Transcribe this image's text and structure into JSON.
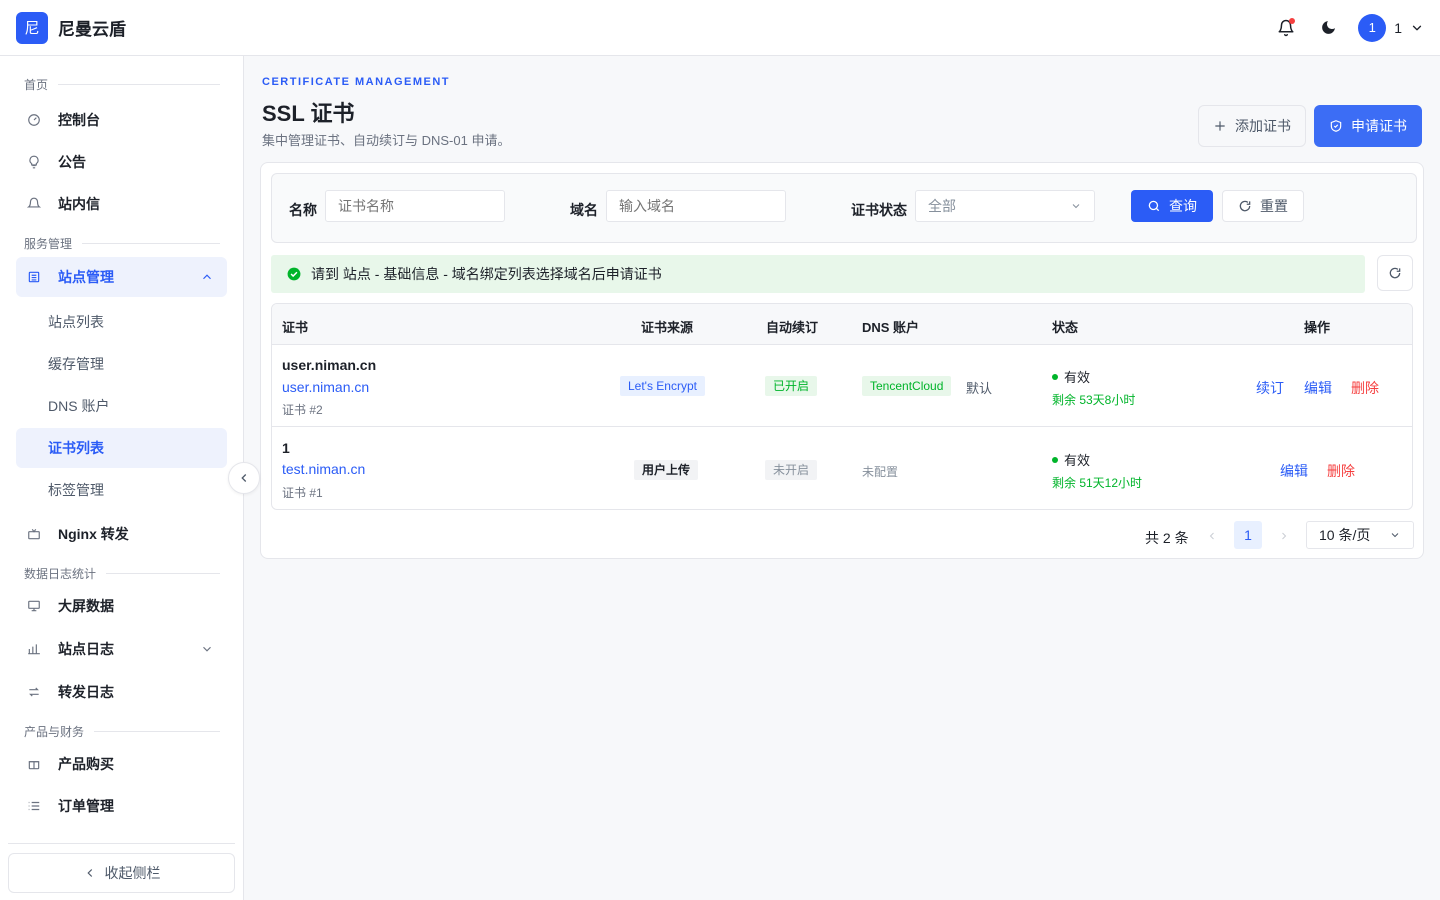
{
  "header": {
    "logo_char": "尼",
    "brand": "尼曼云盾",
    "user_avatar": "1",
    "user_name": "1"
  },
  "sidebar": {
    "section_home": "首页",
    "item_console": "控制台",
    "item_notice": "公告",
    "item_message": "站内信",
    "section_service": "服务管理",
    "item_site": "站点管理",
    "sub_site_list": "站点列表",
    "sub_cache": "缓存管理",
    "sub_dns": "DNS 账户",
    "sub_cert": "证书列表",
    "sub_tags": "标签管理",
    "item_nginx": "Nginx 转发",
    "section_stats": "数据日志统计",
    "item_bigscreen": "大屏数据",
    "item_sitelog": "站点日志",
    "item_forwardlog": "转发日志",
    "section_finance": "产品与财务",
    "item_buy": "产品购买",
    "item_orders": "订单管理",
    "collapse": "收起侧栏"
  },
  "page": {
    "eyebrow": "CERTIFICATE MANAGEMENT",
    "title": "SSL 证书",
    "subtitle": "集中管理证书、自动续订与 DNS-01 申请。",
    "add_button": "添加证书",
    "apply_button": "申请证书"
  },
  "filter": {
    "name_label": "名称",
    "name_placeholder": "证书名称",
    "domain_label": "域名",
    "domain_placeholder": "输入域名",
    "status_label": "证书状态",
    "status_value": "全部",
    "query_button": "查询",
    "reset_button": "重置"
  },
  "alert": {
    "text": "请到 站点 - 基础信息 - 域名绑定列表选择域名后申请证书"
  },
  "table": {
    "headers": {
      "cert": "证书",
      "source": "证书来源",
      "auto": "自动续订",
      "dns": "DNS 账户",
      "status": "状态",
      "ops": "操作"
    },
    "rows": [
      {
        "name": "user.niman.cn",
        "domain": "user.niman.cn",
        "id": "证书 #2",
        "source": "Let's Encrypt",
        "auto": "已开启",
        "dns": "TencentCloud",
        "dns_default": "默认",
        "status": "有效",
        "remain": "剩余 53天8小时",
        "op_renew": "续订",
        "op_edit": "编辑",
        "op_delete": "删除"
      },
      {
        "name": "1",
        "domain": "test.niman.cn",
        "id": "证书 #1",
        "source": "用户上传",
        "auto": "未开启",
        "dns": "未配置",
        "status": "有效",
        "remain": "剩余 51天12小时",
        "op_edit": "编辑",
        "op_delete": "删除"
      }
    ]
  },
  "pagination": {
    "total": "共 2 条",
    "current_page": "1",
    "page_size": "10 条/页"
  },
  "colors": {
    "primary": "#2b5cf6",
    "success": "#00b42a",
    "danger": "#f53f3f"
  }
}
